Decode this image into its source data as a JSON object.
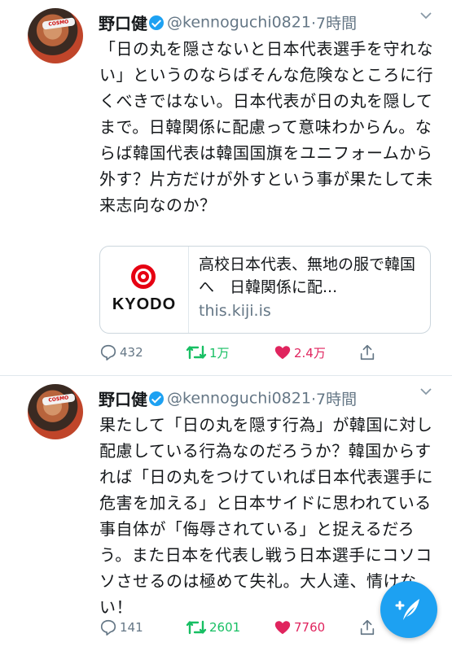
{
  "tweets": [
    {
      "name": "野口健",
      "handle": "@kennoguchi0821",
      "time": "·7時間",
      "text": "「日の丸を隠さないと日本代表選手を守れない」というのならばそんな危険なところに行くべきではない。日本代表が日の丸を隠してまで。日韓関係に配慮って意味わからん。ならば韓国代表は韓国国旗をユニフォームから外す？片方だけが外すという事が果たして未来志向なのか？",
      "card": {
        "logo_text": "KYODO",
        "title": "高校日本代表、無地の服で韓国へ　日韓関係に配...",
        "domain": "this.kiji.is"
      },
      "stats": {
        "replies": "432",
        "retweets": "1万",
        "likes": "2.4万"
      }
    },
    {
      "name": "野口健",
      "handle": "@kennoguchi0821",
      "time": "·7時間",
      "text": "果たして「日の丸を隠す行為」が韓国に対し配慮している行為なのだろうか？韓国からすれば「日の丸をつけていれば日本代表選手に危害を加える」と日本サイドに思われている事自体が「侮辱されている」と捉えるだろう。また日本を代表し戦う日本選手にコソコソさせるのは極めて失礼。大人達、情けない！",
      "stats": {
        "replies": "141",
        "retweets": "2601",
        "likes": "7760"
      }
    }
  ],
  "avatar_band_text": "COSMO",
  "colors": {
    "verified": "#1da1f2",
    "retweet": "#17bf63",
    "like": "#e0245e",
    "muted": "#657786",
    "fab": "#1da1f2"
  },
  "icons": [
    "verified-badge-icon",
    "chevron-down-icon",
    "reply-icon",
    "retweet-icon",
    "like-icon",
    "share-icon",
    "compose-tweet-icon"
  ]
}
